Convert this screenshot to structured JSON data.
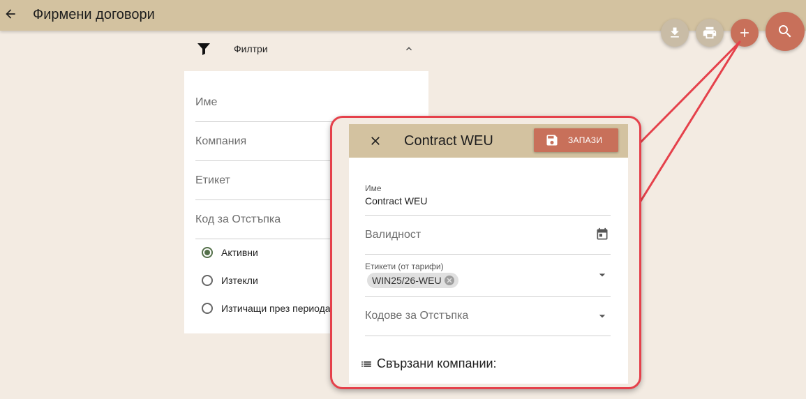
{
  "header": {
    "title": "Фирмени договори"
  },
  "filters": {
    "label": "Филтри",
    "fields": [
      "Име",
      "Компания",
      "Етикет",
      "Код за Отстъпка"
    ],
    "radios": [
      {
        "label": "Активни",
        "checked": true
      },
      {
        "label": "Изтекли",
        "checked": false
      },
      {
        "label": "Изтичащи през периода",
        "checked": false
      }
    ]
  },
  "dialog": {
    "title": "Contract WEU",
    "save_label": "ЗАПАЗИ",
    "name": {
      "label": "Име",
      "value": "Contract WEU"
    },
    "validity": {
      "label": "Валидност"
    },
    "tags": {
      "label": "Етикети (от тарифи)",
      "chip": "WIN25/26-WEU"
    },
    "discount_codes": {
      "label": "Кодове за Отстъпка"
    },
    "linked_companies": "Свързани компании:"
  },
  "icons": {
    "back": "arrow-left-icon",
    "download": "download-icon",
    "print": "print-icon",
    "add": "plus-icon",
    "search": "search-icon",
    "filter": "filter-icon",
    "collapse": "chevron-up-icon",
    "close": "close-icon",
    "save": "floppy-icon",
    "calendar": "calendar-icon",
    "dropdown": "caret-down-icon",
    "list": "list-icon"
  },
  "colors": {
    "toolbar": "#d3c2a0",
    "accent": "#c8705a",
    "secondary_fab": "#c9bca6",
    "background": "#f3ebe2",
    "callout_border": "#e5414b",
    "radio_checked": "#54704a"
  }
}
